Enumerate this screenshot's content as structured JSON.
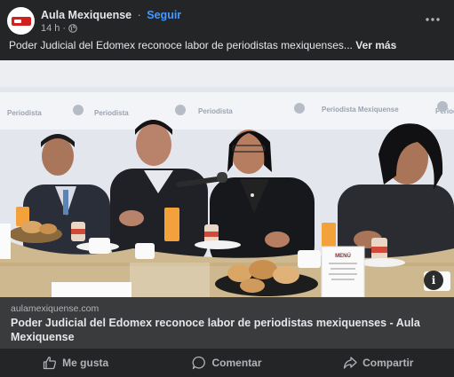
{
  "post": {
    "page_name": "Aula Mexiquense",
    "separator": "·",
    "follow_label": "Seguir",
    "time": "14 h",
    "meta_separator": "·",
    "caption": "Poder Judicial del Edomex reconoce labor de periodistas mexiquenses...",
    "see_more": "Ver más"
  },
  "photo": {
    "banner_texts": [
      "Periodista",
      "Periodista",
      "Periodista",
      "Periodista Mexiquense",
      "Periodista"
    ],
    "menu_card": "MENÚ"
  },
  "link_preview": {
    "domain": "aulamexiquense.com",
    "title": "Poder Judicial del Edomex reconoce labor de periodistas mexiquenses - Aula Mexiquense"
  },
  "actions": {
    "like": "Me gusta",
    "comment": "Comentar",
    "share": "Compartir"
  },
  "colors": {
    "background": "#242526",
    "link_box": "#3a3b3c",
    "follow": "#4599ff",
    "text_primary": "#e4e6eb",
    "text_secondary": "#b0b3b8"
  },
  "icons": [
    "globe-icon",
    "more-icon",
    "info-icon",
    "like-icon",
    "comment-icon",
    "share-icon"
  ]
}
